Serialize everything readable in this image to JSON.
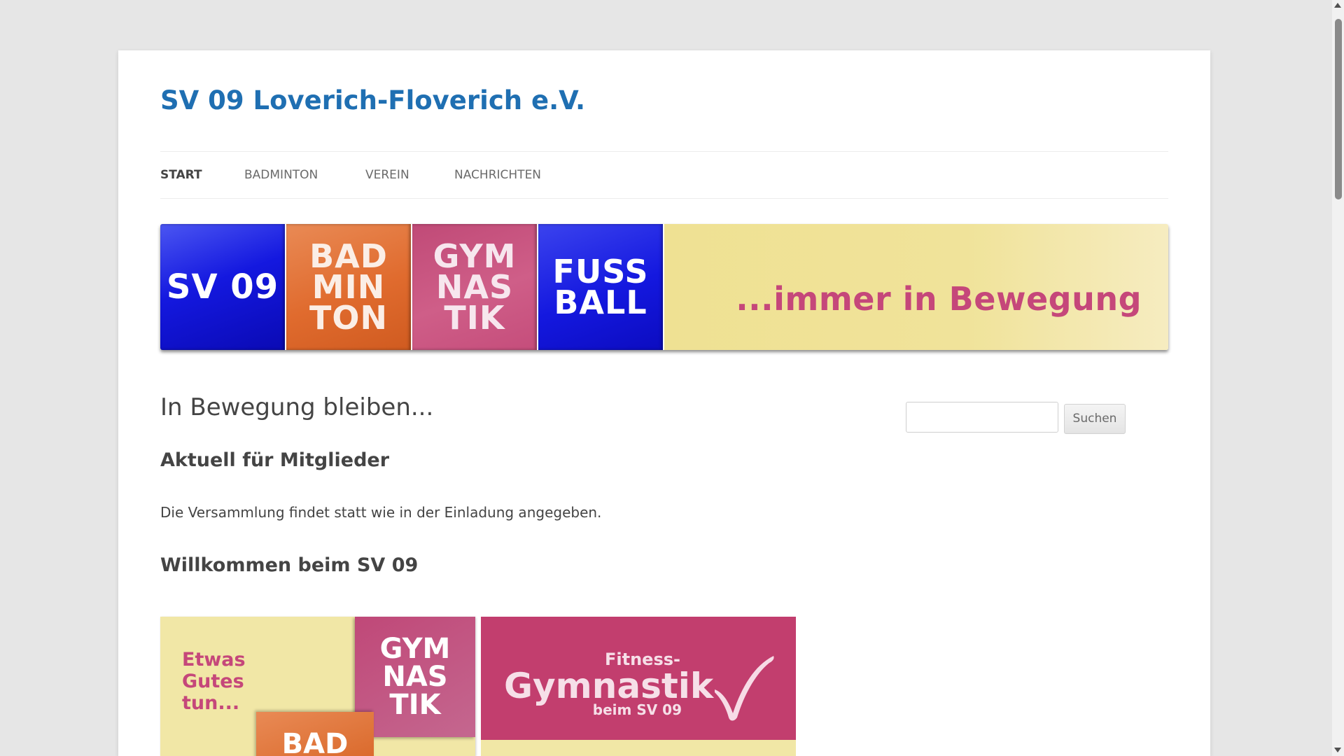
{
  "site": {
    "title": "SV 09 Loverich-Floverich e.V."
  },
  "nav": {
    "items": [
      {
        "label": "START"
      },
      {
        "label": "BADMINTON"
      },
      {
        "label": "VEREIN"
      },
      {
        "label": "NACHRICHTEN"
      }
    ]
  },
  "banner": {
    "tiles": [
      {
        "lines": [
          "SV 09"
        ],
        "color": "#1418df"
      },
      {
        "lines": [
          "BAD",
          "MIN",
          "TON"
        ],
        "color": "#e06b2e"
      },
      {
        "lines": [
          "GYM",
          "NAS",
          "TIK"
        ],
        "color": "#c85481"
      },
      {
        "lines": [
          "FUSS",
          "BALL"
        ],
        "color": "#1418df"
      }
    ],
    "slogan": "...immer in Bewegung",
    "slogan_color": "#c5477a",
    "background_color": "#f0e39a"
  },
  "main": {
    "heading": "In Bewegung bleiben...",
    "section1_title": "Aktuell für Mitglieder",
    "section1_text": "Die Versammlung findet statt wie in der Einladung angegeben.",
    "section2_title": "Willkommen beim SV 09"
  },
  "search": {
    "button_label": "Suchen",
    "value": ""
  },
  "promo1": {
    "lines": [
      "Etwas",
      "Gutes",
      "tun..."
    ],
    "gym_lines": [
      "GYM",
      "NAS",
      "TIK"
    ],
    "bad": "BAD"
  },
  "promo2": {
    "fitness": "Fitness-",
    "gymnastik": "Gymnastik",
    "beim": "beim SV 09",
    "icon": "checkmark-icon"
  },
  "colors": {
    "title_blue": "#1f6fb2",
    "text": "#444444",
    "page_bg": "#e6e6e6"
  }
}
